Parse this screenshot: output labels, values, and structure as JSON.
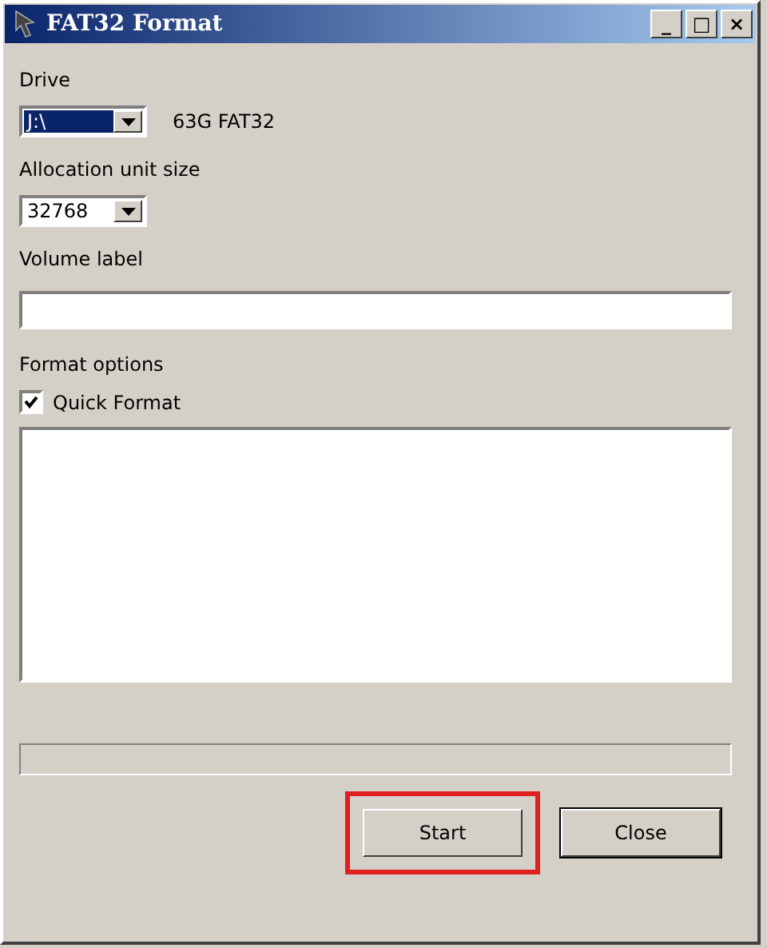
{
  "window": {
    "title": "FAT32 Format",
    "controls": [
      "_",
      "□",
      "×"
    ]
  },
  "drive": {
    "label": "Drive",
    "value": "J:\\",
    "selected": true,
    "info": "63G FAT32"
  },
  "allocation": {
    "label": "Allocation unit size",
    "value": "32768",
    "selected": false
  },
  "volume_label": {
    "label": "Volume label"
  },
  "format_options": {
    "label": "Format options",
    "quick_format": {
      "label": "Quick Format",
      "checked": true
    }
  },
  "progress": {
    "level": 0
  },
  "buttons": [
    {
      "label": "Start",
      "default": false,
      "highlighted": true
    },
    {
      "label": "Close",
      "default": true,
      "highlighted": false
    }
  ]
}
